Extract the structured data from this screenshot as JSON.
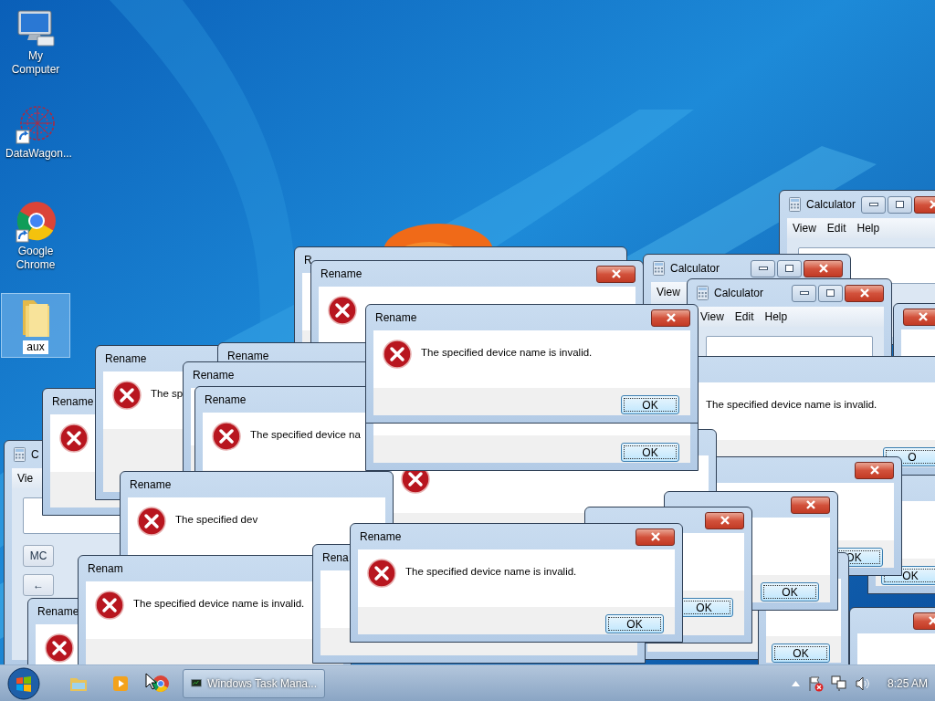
{
  "desktop_icons": [
    {
      "label": "My Computer",
      "selected": false
    },
    {
      "label": "DataWagon...",
      "selected": false
    },
    {
      "label": "Google Chrome",
      "selected": false
    },
    {
      "label": "aux",
      "selected": true
    }
  ],
  "windows": [
    {
      "kind": "calculator",
      "title": "Calculator",
      "menu": [
        "View",
        "Edit",
        "Help"
      ]
    },
    {
      "kind": "dialog",
      "title": "R"
    },
    {
      "kind": "dialog",
      "title": "Rename"
    },
    {
      "kind": "calculator",
      "title": "Calculator",
      "menu": [
        "View"
      ]
    },
    {
      "kind": "calculator",
      "title": "Calculator",
      "menu": [
        "View",
        "Edit",
        "Help"
      ]
    },
    {
      "kind": "dialog"
    },
    {
      "kind": "dialog",
      "message": "The specified device name is invalid.",
      "ok": "O"
    },
    {
      "kind": "dialog",
      "ok": "OK"
    },
    {
      "kind": "dialog",
      "ok": "OK"
    },
    {
      "kind": "calculator",
      "title": "C",
      "menu": [
        "Vie"
      ],
      "keys": [
        "MC",
        "←"
      ]
    },
    {
      "kind": "dialog",
      "title": "Rename"
    },
    {
      "kind": "dialog",
      "title": "Rename",
      "message": "The sp"
    },
    {
      "kind": "dialog",
      "title": "Rename"
    },
    {
      "kind": "dialog",
      "title": "Rename"
    },
    {
      "kind": "dialog",
      "title": "Rename",
      "message": "The specified device na"
    },
    {
      "kind": "dialog"
    },
    {
      "kind": "dialog",
      "title": "Rename",
      "message": "The specified device name is invalid.",
      "ok": "OK"
    },
    {
      "kind": "dialog",
      "ok": "OK"
    },
    {
      "kind": "dialog",
      "title": "Rename",
      "message": "The specified dev"
    },
    {
      "kind": "dialog"
    },
    {
      "kind": "dialog",
      "ok": "OK"
    },
    {
      "kind": "dialog",
      "ok": "OK"
    },
    {
      "kind": "dialog",
      "ok": "OK"
    },
    {
      "kind": "dialog"
    },
    {
      "kind": "dialog",
      "title": "Rename"
    },
    {
      "kind": "dialog",
      "title": "Renam",
      "message": "The specified device name is invalid."
    },
    {
      "kind": "dialog",
      "title": "Rena"
    },
    {
      "kind": "dialog",
      "title": "Rename",
      "message": "The specified device name is invalid.",
      "ok": "OK"
    }
  ],
  "taskbar": {
    "tasks": [
      {
        "label": "Windows Task Mana..."
      }
    ],
    "clock": "8:25 AM"
  }
}
